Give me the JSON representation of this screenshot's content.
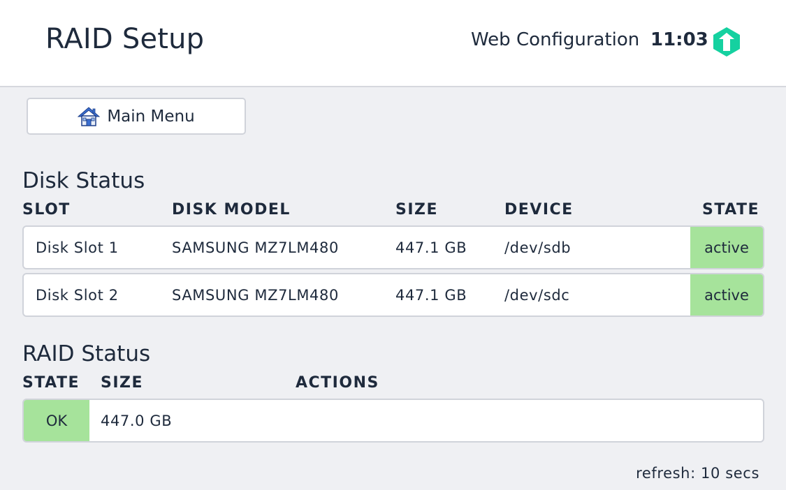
{
  "header": {
    "title": "RAID Setup",
    "subtitle": "Web Configuration",
    "time": "11:03",
    "logo_icon": "checkmk-logo-icon",
    "logo_color": "#15d1a0"
  },
  "nav": {
    "main_menu_label": "Main Menu",
    "main_menu_icon": "home-icon"
  },
  "disk_status": {
    "title": "Disk Status",
    "columns": [
      "SLOT",
      "DISK MODEL",
      "SIZE",
      "DEVICE",
      "STATE"
    ],
    "rows": [
      {
        "slot": "Disk Slot 1",
        "model": "SAMSUNG MZ7LM480",
        "size": "447.1 GB",
        "device": "/dev/sdb",
        "state": "active"
      },
      {
        "slot": "Disk Slot 2",
        "model": "SAMSUNG MZ7LM480",
        "size": "447.1 GB",
        "device": "/dev/sdc",
        "state": "active"
      }
    ]
  },
  "raid_status": {
    "title": "RAID Status",
    "columns": [
      "STATE",
      "SIZE",
      "ACTIONS"
    ],
    "rows": [
      {
        "state": "OK",
        "size": "447.0 GB"
      }
    ]
  },
  "refresh_text": "refresh: 10 secs",
  "colors": {
    "state_ok": "#a6e39b",
    "background": "#eff0f3",
    "text": "#1e2a3c"
  }
}
